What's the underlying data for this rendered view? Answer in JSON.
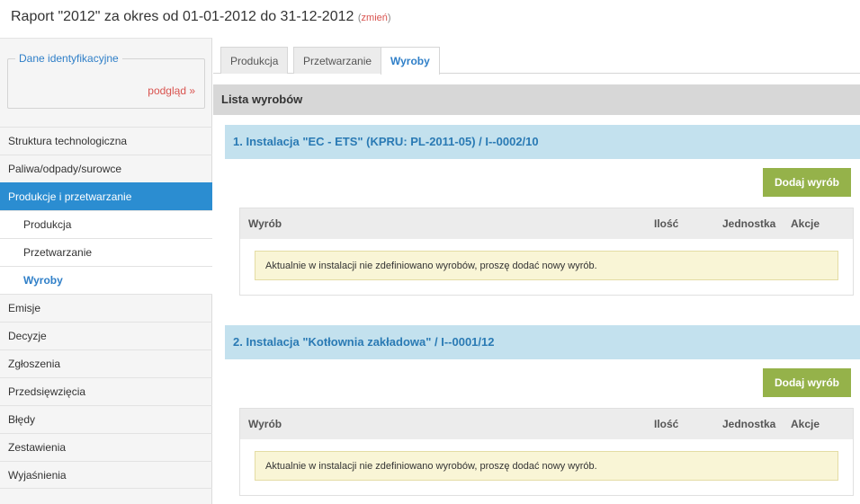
{
  "header": {
    "title": "Raport \"2012\" za okres od 01-01-2012 do 31-12-2012",
    "change_open": "(",
    "change_label": "zmień",
    "change_close": ")"
  },
  "sidebar": {
    "id_box": {
      "legend": "Dane identyfikacyjne",
      "preview": "podgląd »"
    },
    "menu": [
      {
        "label": "Struktura technologiczna"
      },
      {
        "label": "Paliwa/odpady/surowce"
      },
      {
        "label": "Produkcje i przetwarzanie"
      },
      {
        "label": "Produkcja"
      },
      {
        "label": "Przetwarzanie"
      },
      {
        "label": "Wyroby"
      },
      {
        "label": "Emisje"
      },
      {
        "label": "Decyzje"
      },
      {
        "label": "Zgłoszenia"
      },
      {
        "label": "Przedsięwzięcia"
      },
      {
        "label": "Błędy"
      },
      {
        "label": "Zestawienia"
      },
      {
        "label": "Wyjaśnienia"
      }
    ]
  },
  "tabs": [
    {
      "label": "Produkcja"
    },
    {
      "label": "Przetwarzanie"
    },
    {
      "label": "Wyroby"
    }
  ],
  "main": {
    "section_title": "Lista wyrobów",
    "columns": {
      "product": "Wyrób",
      "quantity": "Ilość",
      "unit": "Jednostka",
      "actions": "Akcje"
    },
    "installations": [
      {
        "title": "1. Instalacja \"EC - ETS\" (KPRU: PL-2011-05) / I--0002/10",
        "add_label": "Dodaj wyrób",
        "empty_notice": "Aktualnie w instalacji nie zdefiniowano wyrobów, proszę dodać nowy wyrób."
      },
      {
        "title": "2. Instalacja \"Kotłownia zakładowa\" / I--0001/12",
        "add_label": "Dodaj wyrób",
        "empty_notice": "Aktualnie w instalacji nie zdefiniowano wyrobów, proszę dodać nowy wyrób."
      }
    ]
  },
  "colors": {
    "accent": "#2b8dd1",
    "link_red": "#d9534f",
    "button_green": "#95b24a",
    "installation_header": "#c3e1ee",
    "notice_bg": "#f9f5d6"
  }
}
